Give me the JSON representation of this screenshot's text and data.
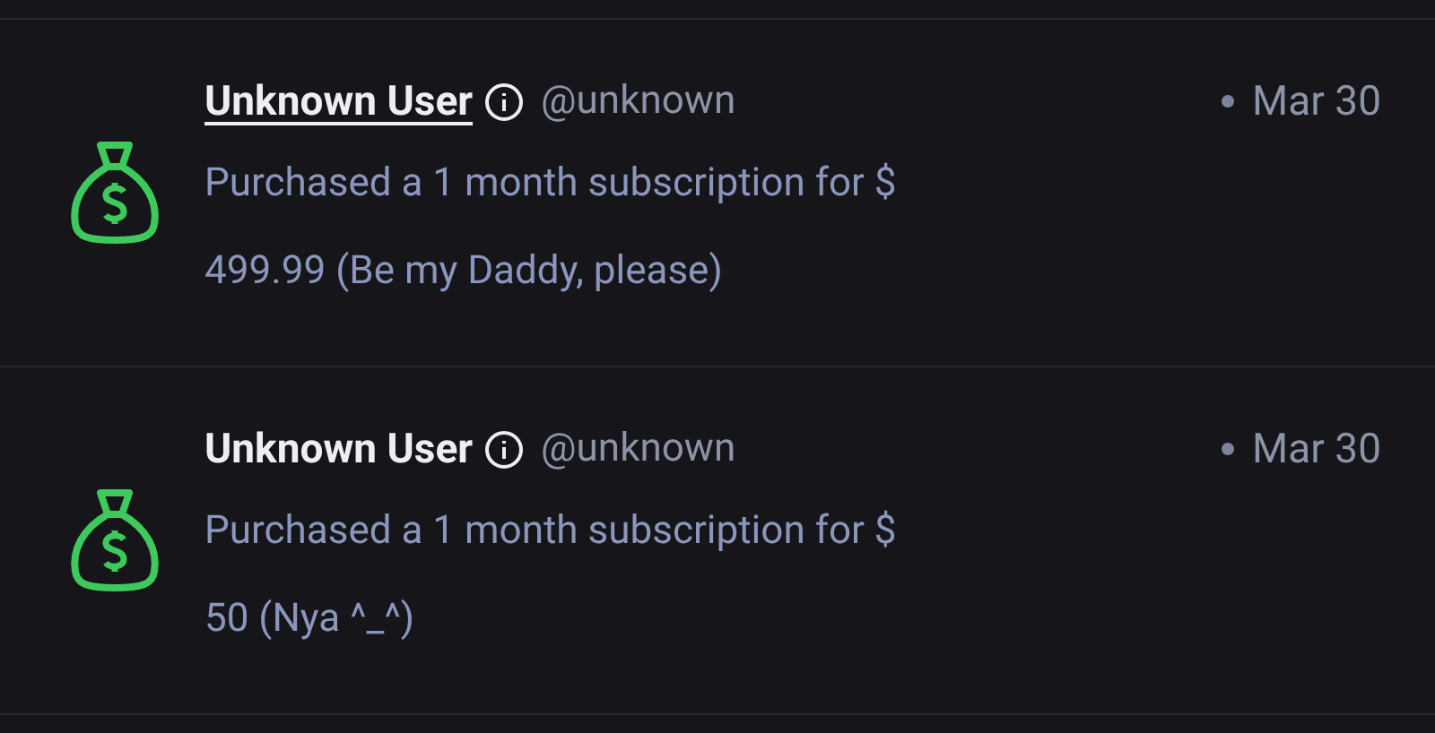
{
  "notifications": [
    {
      "name": "Unknown User",
      "underlined": true,
      "handle": "@unknown",
      "date": "Mar 30",
      "text": "Purchased a 1 month subscription for $ 499.99 (Be my Daddy, please)"
    },
    {
      "name": "Unknown User",
      "underlined": false,
      "handle": "@unknown",
      "date": "Mar 30",
      "text": "Purchased a 1 month subscription for $ 50 (Nya ^_^)"
    }
  ]
}
